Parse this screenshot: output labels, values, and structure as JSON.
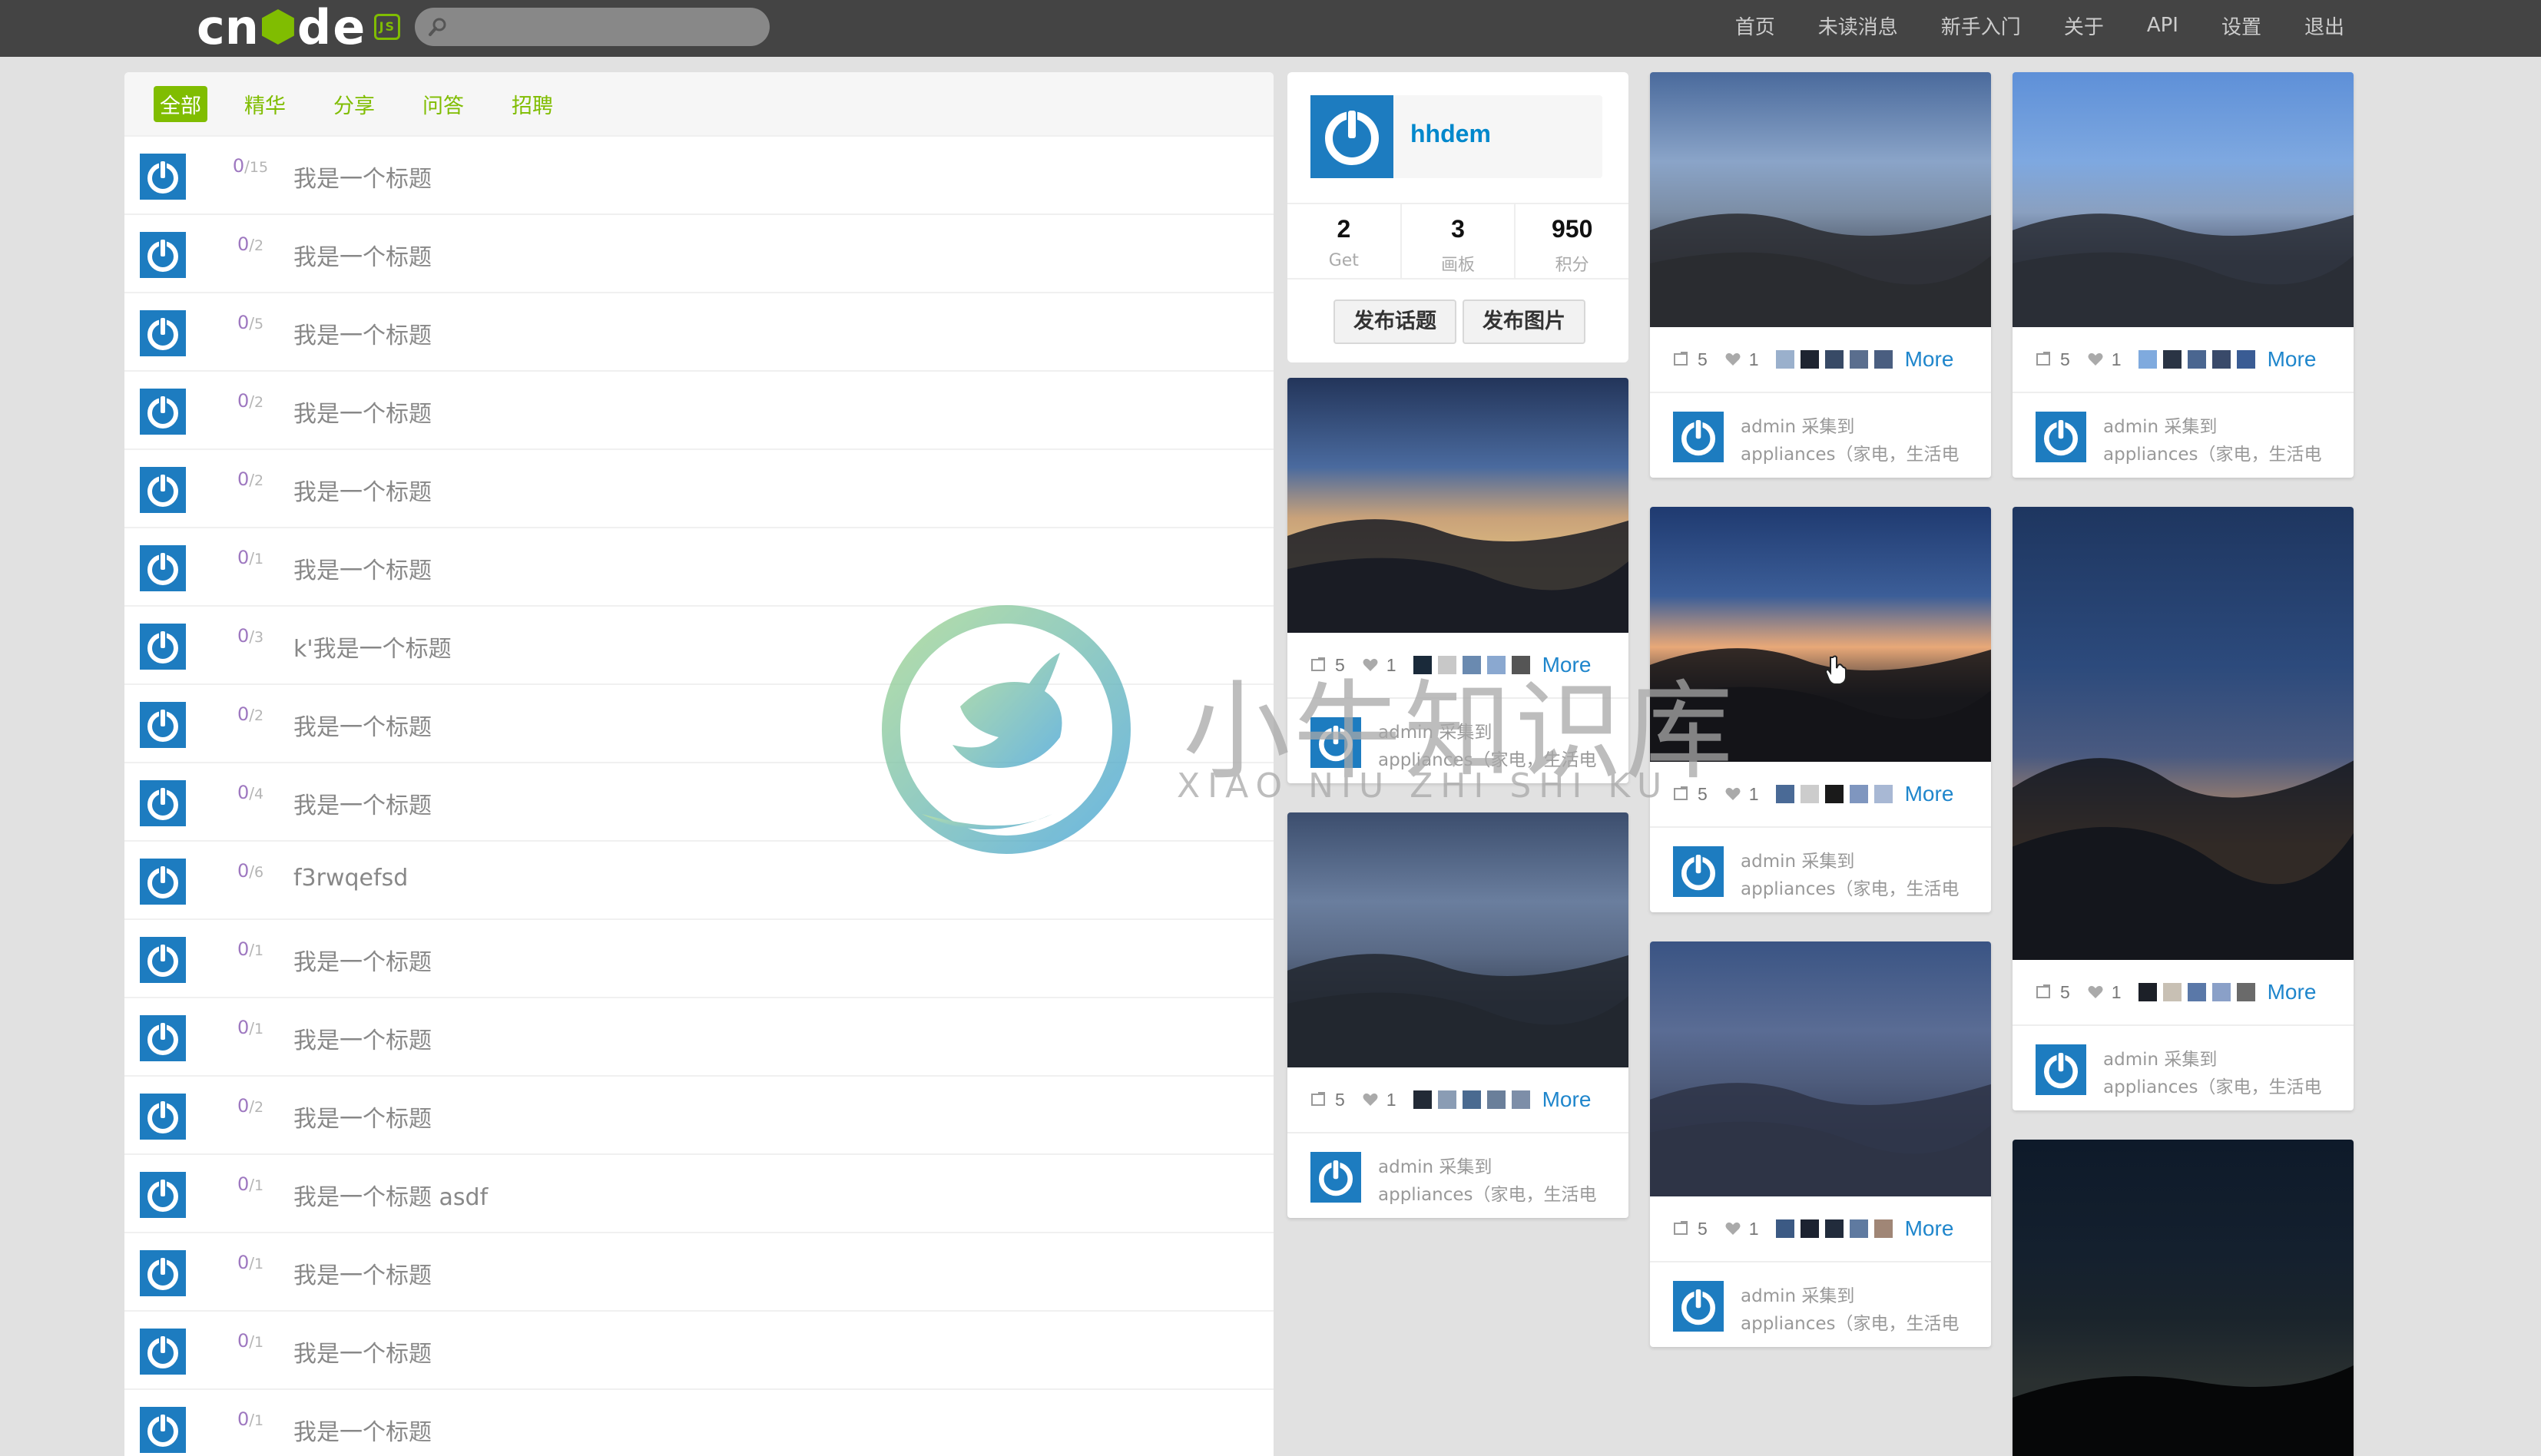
{
  "navbar": {
    "logo": "cnode",
    "logo_badge": "JS",
    "search_placeholder": "",
    "links": [
      "首页",
      "未读消息",
      "新手入门",
      "关于",
      "API",
      "设置",
      "退出"
    ]
  },
  "topics": {
    "tabs": [
      "全部",
      "精华",
      "分享",
      "问答",
      "招聘"
    ],
    "active_tab": "全部",
    "rows": [
      {
        "replies": "0",
        "visits": "15",
        "title": "我是一个标题"
      },
      {
        "replies": "0",
        "visits": "2",
        "title": "我是一个标题"
      },
      {
        "replies": "0",
        "visits": "5",
        "title": "我是一个标题"
      },
      {
        "replies": "0",
        "visits": "2",
        "title": "我是一个标题"
      },
      {
        "replies": "0",
        "visits": "2",
        "title": "我是一个标题"
      },
      {
        "replies": "0",
        "visits": "1",
        "title": "我是一个标题"
      },
      {
        "replies": "0",
        "visits": "3",
        "title": "k'我是一个标题"
      },
      {
        "replies": "0",
        "visits": "2",
        "title": "我是一个标题"
      },
      {
        "replies": "0",
        "visits": "4",
        "title": "我是一个标题"
      },
      {
        "replies": "0",
        "visits": "6",
        "title": "f3rwqefsd"
      },
      {
        "replies": "0",
        "visits": "1",
        "title": "我是一个标题"
      },
      {
        "replies": "0",
        "visits": "1",
        "title": "我是一个标题"
      },
      {
        "replies": "0",
        "visits": "2",
        "title": "我是一个标题"
      },
      {
        "replies": "0",
        "visits": "1",
        "title": "我是一个标题 asdf"
      },
      {
        "replies": "0",
        "visits": "1",
        "title": "我是一个标题"
      },
      {
        "replies": "0",
        "visits": "1",
        "title": "我是一个标题"
      },
      {
        "replies": "0",
        "visits": "1",
        "title": "我是一个标题"
      }
    ]
  },
  "user": {
    "name": "hhdem",
    "stats": [
      {
        "num": "2",
        "label": "Get"
      },
      {
        "num": "3",
        "label": "画板"
      },
      {
        "num": "950",
        "label": "积分"
      }
    ],
    "btn_topic": "发布话题",
    "btn_image": "发布图片"
  },
  "pins": [
    {
      "repins": "5",
      "likes": "1",
      "colors": [
        "#1a2a3a",
        "#c8c8c8",
        "#6a8ab0",
        "#8aa8d0",
        "#555555"
      ],
      "more": "More",
      "collector": "admin 采集到",
      "board": "appliances（家电，生活电"
    },
    {
      "repins": "5",
      "likes": "1",
      "colors": [
        "#222a36",
        "#8a9cb4",
        "#4a6a90",
        "#6a7f9a",
        "#7d8ea8"
      ],
      "more": "More",
      "collector": "admin 采集到",
      "board": "appliances（家电，生活电"
    },
    {
      "repins": "5",
      "likes": "1",
      "colors": [
        "#9ab0cc",
        "#1e2430",
        "#384a66",
        "#5a6e8e",
        "#4a5e80"
      ],
      "more": "More",
      "collector": "admin 采集到",
      "board": "appliances（家电，生活电"
    },
    {
      "repins": "5",
      "likes": "1",
      "colors": [
        "#4a6a96",
        "#cccccc",
        "#1a1a1a",
        "#7f96bf",
        "#a8b8d4"
      ],
      "more": "More",
      "collector": "admin 采集到",
      "board": "appliances（家电，生活电"
    },
    {
      "repins": "5",
      "likes": "1",
      "colors": [
        "#3c5a84",
        "#1c2230",
        "#222c3c",
        "#5f7aa0",
        "#a08676"
      ],
      "more": "More",
      "collector": "admin 采集到",
      "board": "appliances（家电，生活电"
    },
    {
      "repins": "5",
      "likes": "1",
      "colors": [
        "#7faade",
        "#2a3444",
        "#4a6690",
        "#394a6a",
        "#3a5c94"
      ],
      "more": "More",
      "collector": "admin 采集到",
      "board": "appliances（家电，生活电"
    },
    {
      "repins": "5",
      "likes": "1",
      "colors": [
        "#1c2028",
        "#c8c0b4",
        "#5a78a8",
        "#8aa0c8",
        "#6a6a6a"
      ],
      "more": "More",
      "collector": "admin 采集到",
      "board": "appliances（家电，生活电"
    }
  ],
  "watermark": {
    "text": "小牛知识库",
    "sub": "XIAO NIU ZHI SHI KU"
  }
}
